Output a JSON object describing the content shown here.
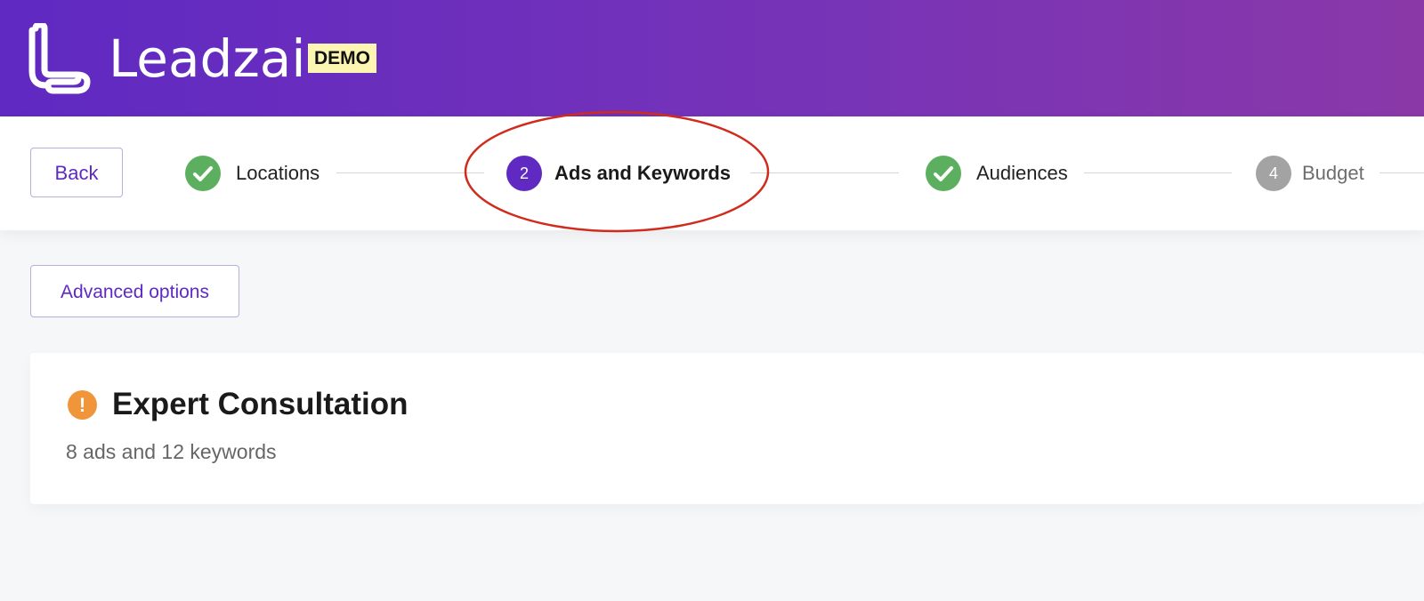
{
  "header": {
    "brand": "Leadzai",
    "badge": "DEMO"
  },
  "stepbar": {
    "back_label": "Back",
    "steps": [
      {
        "label": "Locations",
        "state": "done",
        "icon": "check-icon"
      },
      {
        "label": "Ads and Keywords",
        "state": "active",
        "number": "2"
      },
      {
        "label": "Audiences",
        "state": "done",
        "icon": "check-icon"
      },
      {
        "label": "Budget",
        "state": "pending",
        "number": "4"
      }
    ]
  },
  "toolbar": {
    "advanced_label": "Advanced options"
  },
  "card": {
    "title": "Expert Consultation",
    "subtitle": "8 ads and 12 keywords",
    "status_icon": "warning-icon"
  },
  "colors": {
    "accent": "#5f29c2",
    "success": "#5caf5e",
    "warning": "#f0953a",
    "annotation": "#d02b1c"
  }
}
